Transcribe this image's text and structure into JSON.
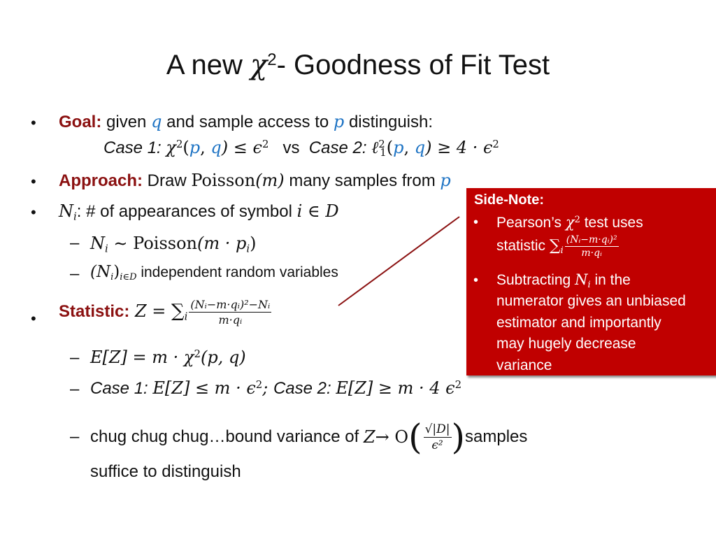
{
  "title": {
    "prefix": "A new ",
    "symbol": "χ",
    "sup": "2",
    "suffix": "- Goodness of Fit Test"
  },
  "bullets": {
    "goal": {
      "label": "Goal:",
      "text1": " given ",
      "q": "q",
      "text2": " and sample access to ",
      "p": "p",
      "text3": " distinguish:",
      "case1_label": "Case 1: ",
      "case1_math_pre": "χ",
      "case1_sup": "2",
      "case1_open": "(",
      "case1_p": "p",
      "case1_comma": ", ",
      "case1_q": "q",
      "case1_close": ") ≤ ϵ",
      "case1_eps_sup": "2",
      "vs": "vs",
      "case2_label": "Case 2: ",
      "case2_ell": "ℓ",
      "case2_sup": "2",
      "case2_sub": "1",
      "case2_open": "(",
      "case2_p": "p",
      "case2_comma": ", ",
      "case2_q": "q",
      "case2_close": ") ≥ 4 · ϵ",
      "case2_eps_sup": "2"
    },
    "approach": {
      "label": "Approach:",
      "text1": " Draw ",
      "poisson": "Poisson",
      "m": "(m)",
      "text2": " many samples from ",
      "p": "p"
    },
    "ni": {
      "N": "N",
      "sub": "i",
      "text": ": # of appearances of symbol ",
      "member": "i ∈ D",
      "sub1": {
        "N": "N",
        "sub": "i",
        "tilde": " ∼ ",
        "poisson": "Poisson",
        "arg_open": "(m · p",
        "arg_sub": "i",
        "arg_close": ")"
      },
      "sub2": {
        "math": "(N",
        "sub_i": "i",
        "close": ")",
        "sub": "i∈D",
        "text": " independent random variables"
      }
    },
    "statistic": {
      "label": "Statistic:",
      "lhs": " Z = ",
      "sum": "∑",
      "sum_sub": "i",
      "num": "(Nᵢ−m·qᵢ)²−Nᵢ",
      "den": "m·qᵢ",
      "sub1": {
        "math": "E[Z] = m · χ",
        "sup": "2",
        "rest": "(p, q)"
      },
      "sub2": {
        "case1_label": "Case 1: ",
        "case1_math": "E[Z] ≤ m · ϵ",
        "case1_sup": "2",
        "sep": "; ",
        "case2_label": "Case 2: ",
        "case2_math": "E[Z] ≥ m · 4 ϵ",
        "case2_sup": "2"
      },
      "sub3": {
        "text1": "chug chug chug…bound variance of ",
        "Z": "Z",
        "arrow": " → O",
        "num": "√|D|",
        "den": "ϵ²",
        "text2": " samples",
        "text3": "suffice to distinguish"
      }
    }
  },
  "sidenote": {
    "title": "Side-Note:",
    "item1_line1_text": "Pearson’s ",
    "item1_chi": "χ",
    "item1_sup": "2",
    "item1_line1_rest": " test uses",
    "item1_line2_text": "statistic ",
    "item1_sum": "∑",
    "item1_sum_sub": "i",
    "item1_num": "(Nᵢ−m·qᵢ)²",
    "item1_den": "m·qᵢ",
    "item2_line1_text": "Subtracting ",
    "item2_N": "N",
    "item2_sub": "i",
    "item2_line1_rest": " in the",
    "item2_line2": "numerator gives an unbiased",
    "item2_line3": "estimator and importantly",
    "item2_line4": "may hugely decrease",
    "item2_line5": "variance"
  },
  "bullet_glyph": "•",
  "dash_glyph": "–",
  "colors": {
    "accent": "#8b1111",
    "math_blue": "#1f74c4",
    "sidenote_bg": "#c00000",
    "connector": "#8b1111"
  }
}
